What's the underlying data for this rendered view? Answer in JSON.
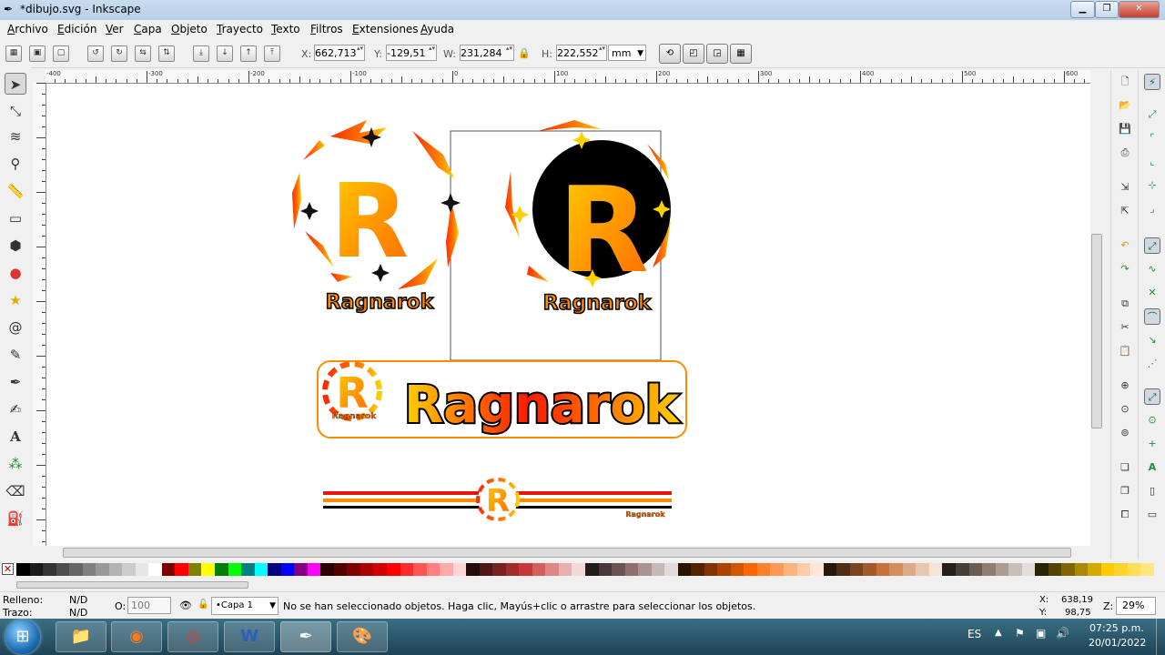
{
  "window": {
    "title": "*dibujo.svg - Inkscape"
  },
  "menu": [
    "Archivo",
    "Edición",
    "Ver",
    "Capa",
    "Objeto",
    "Trayecto",
    "Texto",
    "Filtros",
    "Extensiones",
    "Ayuda"
  ],
  "toolbar": {
    "x_label": "X:",
    "x_value": "662,713",
    "y_label": "Y:",
    "y_value": "-129,51",
    "w_label": "W:",
    "w_value": "231,284",
    "h_label": "H:",
    "h_value": "222,552",
    "unit": "mm"
  },
  "ruler": {
    "labels": [
      "-400",
      "-300",
      "-200",
      "-100",
      "0",
      "100",
      "200",
      "300",
      "400",
      "500",
      "600"
    ]
  },
  "artwork": {
    "logo_text": "Ragnarok",
    "monogram": "R"
  },
  "colors": {
    "orange": "#ff8c00",
    "yellow": "#ffc000",
    "red": "#e8150b",
    "black": "#000000",
    "accent": "#1c8f3a"
  },
  "palette": [
    "#000000",
    "#1a1a1a",
    "#333333",
    "#4d4d4d",
    "#666666",
    "#808080",
    "#999999",
    "#b3b3b3",
    "#cccccc",
    "#e6e6e6",
    "#ffffff",
    "#800000",
    "#ff0000",
    "#808000",
    "#ffff00",
    "#008000",
    "#00ff00",
    "#008080",
    "#00ffff",
    "#000080",
    "#0000ff",
    "#800080",
    "#ff00ff",
    "#2b0000",
    "#550000",
    "#800000",
    "#aa0000",
    "#d40000",
    "#ff0000",
    "#ff2a2a",
    "#ff5555",
    "#ff8080",
    "#ffaaaa",
    "#ffd5d5",
    "#280b0b",
    "#501616",
    "#782121",
    "#a02c2c",
    "#c83737",
    "#d35f5f",
    "#de8787",
    "#e9afaf",
    "#f4d7d7",
    "#241c1c",
    "#483737",
    "#6c5353",
    "#916f6f",
    "#ac9393",
    "#c8b7b7",
    "#e3dbdb",
    "#2b1100",
    "#552200",
    "#803300",
    "#aa4400",
    "#d45500",
    "#ff6600",
    "#ff7f2a",
    "#ff9955",
    "#ffb380",
    "#ffccaa",
    "#ffe6d5",
    "#28170b",
    "#502d16",
    "#784421",
    "#a05a2c",
    "#c87137",
    "#d38d5f",
    "#deaa87",
    "#e9c6af",
    "#f4e3d7",
    "#241f1c",
    "#483e37",
    "#6c5d53",
    "#917c6f",
    "#ac9d93",
    "#c8beb7",
    "#e3dedb",
    "#2b2200",
    "#554400",
    "#806600",
    "#aa8800",
    "#d4aa00",
    "#ffcc00",
    "#ffd42a",
    "#ffdd55",
    "#ffe680"
  ],
  "status": {
    "fill_label": "Relleno:",
    "fill_value": "N/D",
    "stroke_label": "Trazo:",
    "stroke_value": "N/D",
    "opacity_label": "O:",
    "opacity_value": "100",
    "layer": "•Capa 1",
    "message": "No se han seleccionado objetos. Haga clic, Mayús+clic o arrastre para seleccionar los objetos.",
    "cursor_x_label": "X:",
    "cursor_x": "638,19",
    "cursor_y_label": "Y:",
    "cursor_y": "98,75",
    "zoom_label": "Z:",
    "zoom": "29%"
  },
  "taskbar": {
    "lang": "ES",
    "time": "07:25 p.m.",
    "date": "20/01/2022"
  }
}
